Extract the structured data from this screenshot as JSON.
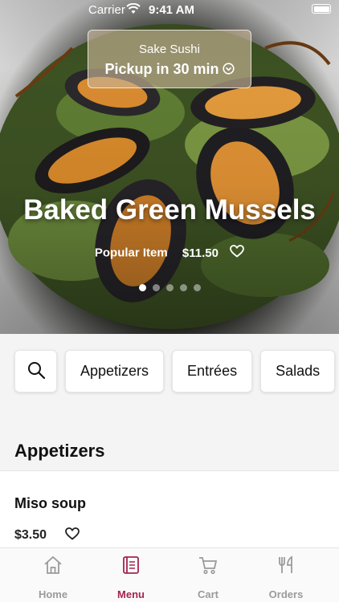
{
  "status_bar": {
    "carrier": "Carrier",
    "time": "9:41 AM"
  },
  "location": {
    "store_name": "Sake Sushi",
    "pickup": "Pickup in 30 min"
  },
  "hero": {
    "title": "Baked Green Mussels",
    "tag": "Popular Item",
    "price": "$11.50",
    "carousel": {
      "count": 5,
      "active_index": 0
    }
  },
  "categories": [
    "Appetizers",
    "Entrées",
    "Salads"
  ],
  "section": {
    "title": "Appetizers"
  },
  "menu_items": [
    {
      "name": "Miso soup",
      "price": "$3.50"
    }
  ],
  "tabs": [
    {
      "label": "Home",
      "icon": "house-icon",
      "active": false
    },
    {
      "label": "Menu",
      "icon": "menu-book-icon",
      "active": true
    },
    {
      "label": "Cart",
      "icon": "cart-icon",
      "active": false
    },
    {
      "label": "Orders",
      "icon": "fork-knife-icon",
      "active": false
    }
  ],
  "colors": {
    "accent": "#a4254f",
    "tab_inactive": "#9b9b9b"
  }
}
